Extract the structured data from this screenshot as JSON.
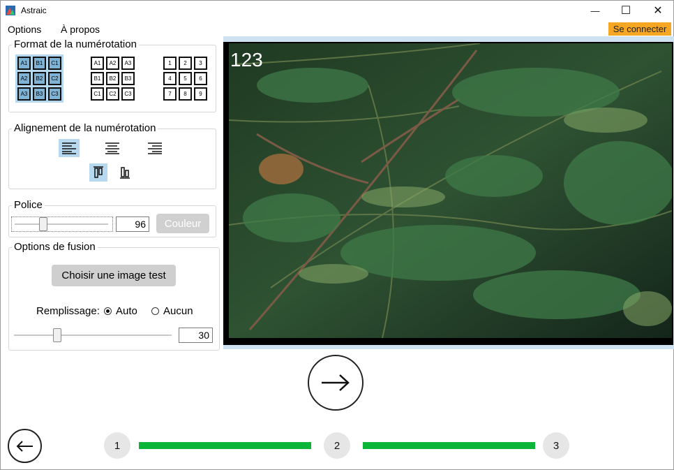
{
  "window": {
    "title": "Astraic",
    "minimize": "—",
    "maximize": "☐",
    "close": "✕"
  },
  "menu": {
    "options": "Options",
    "about": "À propos",
    "login": "Se connecter"
  },
  "format": {
    "title": "Format de la numérotation",
    "options": [
      {
        "cells": [
          "A1",
          "B1",
          "C1",
          "A2",
          "B2",
          "C2",
          "A3",
          "B3",
          "C3"
        ],
        "selected": true
      },
      {
        "cells": [
          "A1",
          "A2",
          "A3",
          "B1",
          "B2",
          "B3",
          "C1",
          "C2",
          "C3"
        ],
        "selected": false
      },
      {
        "cells": [
          "1",
          "2",
          "3",
          "4",
          "5",
          "6",
          "7",
          "8",
          "9"
        ],
        "selected": false
      }
    ]
  },
  "alignment": {
    "title": "Alignement de la numérotation",
    "horizontal": [
      "align-left-icon",
      "align-center-icon",
      "align-right-icon"
    ],
    "horizontal_selected": "align-left-icon",
    "vertical": [
      "align-top-icon",
      "align-bottom-icon"
    ],
    "vertical_selected": "align-top-icon"
  },
  "font": {
    "title": "Police",
    "size": "96",
    "size_slider_fraction": 0.3,
    "color_button": "Couleur"
  },
  "fusion": {
    "title": "Options de fusion",
    "choose_image": "Choisir une image test",
    "fill_label": "Remplissage:",
    "fill_auto": "Auto",
    "fill_none": "Aucun",
    "fill_selected": "auto",
    "value": "30",
    "slider_fraction": 0.27
  },
  "preview": {
    "overlay_number": "123"
  },
  "navigation": {
    "next_icon": "arrow-right-icon",
    "back_icon": "arrow-left-icon",
    "steps": [
      "1",
      "2",
      "3"
    ],
    "accent": "#0ab53a"
  }
}
